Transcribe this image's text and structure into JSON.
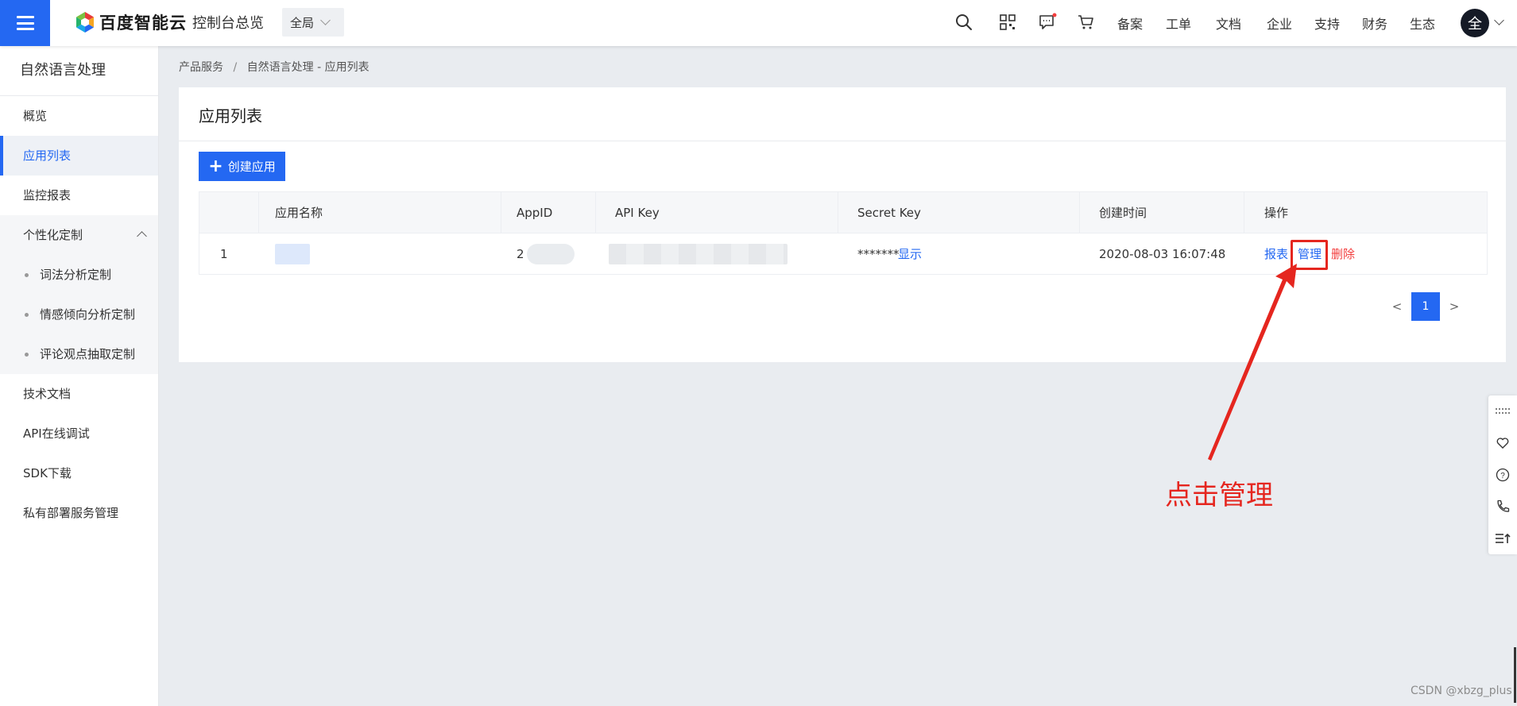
{
  "topbar": {
    "brand": "百度智能云",
    "console_title": "控制台总览",
    "region_label": "全局",
    "icons": [
      "search-icon",
      "qrcode-icon",
      "message-icon",
      "cart-icon"
    ],
    "nav": [
      "备案",
      "工单",
      "文档",
      "企业",
      "支持",
      "财务",
      "生态"
    ],
    "avatar_text": "全",
    "accent_color": "#2468f2"
  },
  "sidebar": {
    "title": "自然语言处理",
    "items": [
      {
        "label": "概览"
      },
      {
        "label": "应用列表",
        "active": true
      },
      {
        "label": "监控报表"
      },
      {
        "label": "个性化定制",
        "expanded": true
      },
      {
        "label": "技术文档"
      },
      {
        "label": "API在线调试"
      },
      {
        "label": "SDK下载"
      },
      {
        "label": "私有部署服务管理"
      }
    ],
    "sub_items": [
      "词法分析定制",
      "情感倾向分析定制",
      "评论观点抽取定制"
    ]
  },
  "breadcrumb": {
    "parent": "产品服务",
    "separator": "/",
    "current": "自然语言处理 - 应用列表"
  },
  "main": {
    "title": "应用列表",
    "create_button": "创建应用",
    "table": {
      "columns": [
        "",
        "应用名称",
        "AppID",
        "API Key",
        "Secret Key",
        "创建时间",
        "操作"
      ],
      "rows": [
        {
          "index": "1",
          "name": "",
          "app_id": "2",
          "api_key": "",
          "secret_key_masked": "*******",
          "secret_show": "显示",
          "created": "2020-08-03 16:07:48",
          "actions": {
            "report": "报表",
            "manage": "管理",
            "delete": "删除"
          }
        }
      ]
    },
    "pagination": {
      "prev": "<",
      "current": "1",
      "next": ">"
    }
  },
  "annotation": {
    "text": "点击管理",
    "color": "#e5261f"
  },
  "float_toolbar": {
    "icons": [
      "drag-handle-icon",
      "heart-icon",
      "help-icon",
      "phone-icon",
      "list-top-icon"
    ]
  },
  "watermark": "CSDN @xbzg_plus"
}
